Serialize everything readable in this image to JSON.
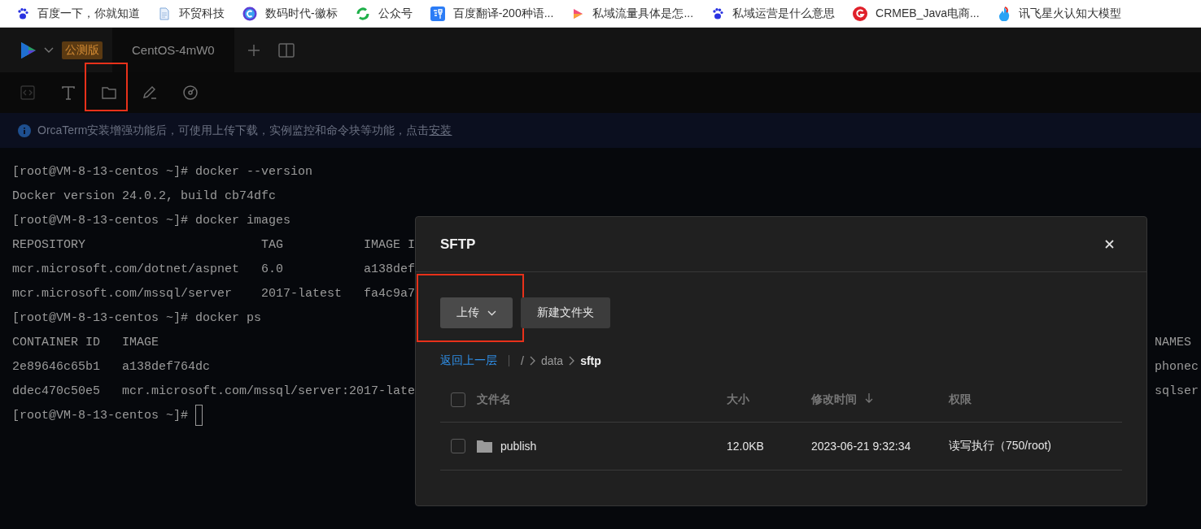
{
  "bookmarks": [
    {
      "label": "百度一下，你就知道",
      "kind": "paw"
    },
    {
      "label": "环贸科技",
      "kind": "page"
    },
    {
      "label": "数码时代-徽标",
      "kind": "ring"
    },
    {
      "label": "公众号",
      "kind": "swirl"
    },
    {
      "label": "百度翻译-200种语...",
      "kind": "translate"
    },
    {
      "label": "私域流量具体是怎...",
      "kind": "play"
    },
    {
      "label": "私域运营是什么意思",
      "kind": "paw"
    },
    {
      "label": "CRMEB_Java电商...",
      "kind": "g"
    },
    {
      "label": "讯飞星火认知大模型",
      "kind": "flame"
    }
  ],
  "app": {
    "badge": "公测版",
    "tabs": [
      {
        "label": "CentOS-4mW0",
        "selected": true
      }
    ],
    "toolbar": [
      {
        "kind": "code",
        "disabled": true,
        "highlighted": false
      },
      {
        "kind": "text",
        "disabled": false,
        "highlighted": false
      },
      {
        "kind": "folder",
        "disabled": false,
        "highlighted": true
      },
      {
        "kind": "edit",
        "disabled": false,
        "highlighted": false
      },
      {
        "kind": "gauge",
        "disabled": false,
        "highlighted": false
      }
    ],
    "notice": {
      "text": "OrcaTerm安装增强功能后，可使用上传下载，实例监控和命令块等功能，点击",
      "link": "安装"
    }
  },
  "terminal": {
    "lines": [
      {
        "text": "[root@VM-8-13-centos ~]# docker --version",
        "cursor": false
      },
      {
        "text": "Docker version 24.0.2, build cb74dfc",
        "cursor": false
      },
      {
        "text": "[root@VM-8-13-centos ~]# docker images",
        "cursor": false
      },
      {
        "text": "REPOSITORY                        TAG           IMAGE I",
        "cursor": false
      },
      {
        "text": "mcr.microsoft.com/dotnet/aspnet   6.0           a138def",
        "cursor": false
      },
      {
        "text": "mcr.microsoft.com/mssql/server    2017-latest   fa4c9a7",
        "cursor": false
      },
      {
        "text": "[root@VM-8-13-centos ~]# docker ps",
        "cursor": false
      },
      {
        "text": "CONTAINER ID   IMAGE",
        "right": "NAMES",
        "cursor": false
      },
      {
        "text": "2e89646c65b1   a138def764dc",
        "right": "phonec",
        "cursor": false
      },
      {
        "text": "ddec470c50e5   mcr.microsoft.com/mssql/server:2017-late",
        "right": "sqlser",
        "cursor": false
      },
      {
        "text": "[root@VM-8-13-centos ~]#",
        "cursor": true
      }
    ]
  },
  "sftp": {
    "title": "SFTP",
    "buttons": [
      {
        "label": "上传",
        "kind": "dropdown",
        "highlighted": true
      },
      {
        "label": "新建文件夹",
        "kind": "plain",
        "highlighted": false
      }
    ],
    "back_link": "返回上一层",
    "path": [
      "/",
      "data",
      "sftp"
    ],
    "columns": [
      {
        "label": "文件名",
        "sorted": false
      },
      {
        "label": "大小",
        "sorted": false
      },
      {
        "label": "修改时间",
        "sorted": true
      },
      {
        "label": "权限",
        "sorted": false
      }
    ],
    "select_all": {
      "checked": false
    },
    "rows": [
      {
        "kind": "folder",
        "name": "publish",
        "size": "12.0KB",
        "modified": "2023-06-21 9:32:34",
        "permissions": "读写执行（750/root)",
        "checked": false
      }
    ]
  }
}
